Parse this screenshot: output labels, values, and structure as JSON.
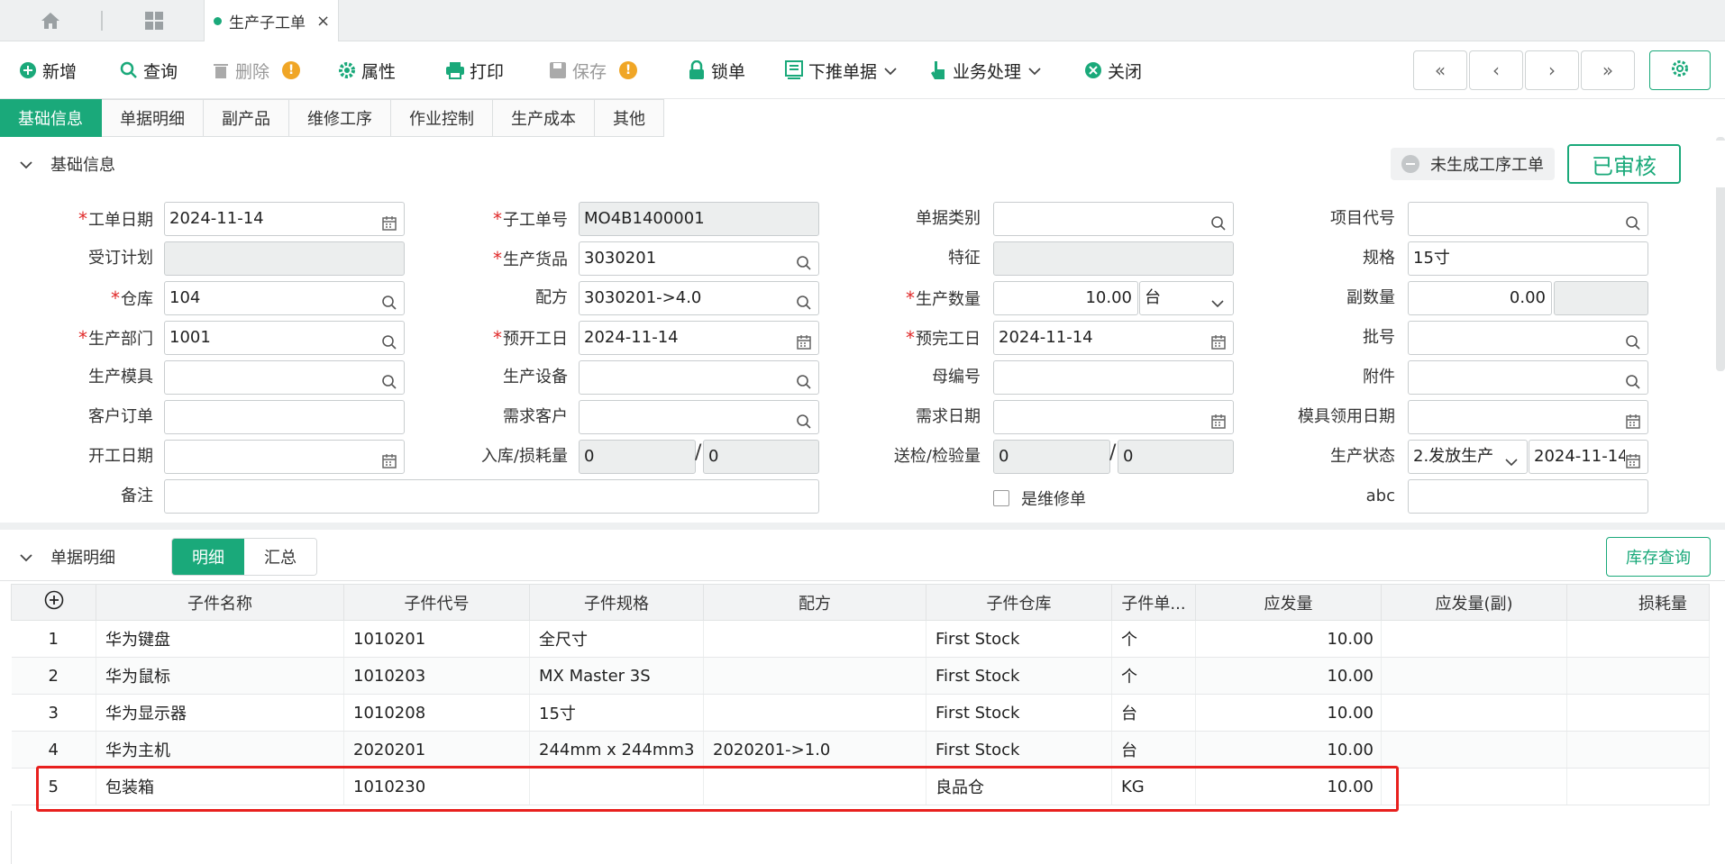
{
  "tabbar": {
    "active_tab": "生产子工单",
    "close": "×"
  },
  "toolbar": {
    "new": "新增",
    "query": "查询",
    "delete": "删除",
    "attr": "属性",
    "print": "打印",
    "save": "保存",
    "lock": "锁单",
    "push": "下推单据",
    "biz": "业务处理",
    "close": "关闭",
    "warn_mark": "!",
    "nav": [
      "«",
      "‹",
      "›",
      "»"
    ]
  },
  "subtabs": [
    "基础信息",
    "单据明细",
    "副产品",
    "维修工序",
    "作业控制",
    "生产成本",
    "其他"
  ],
  "basic": {
    "section_title": "基础信息",
    "unbuilt": "未生成工序工单",
    "approved": "已审核",
    "labels": {
      "work_date": "工单日期",
      "sub_no": "子工单号",
      "doc_type": "单据类别",
      "project": "项目代号",
      "order_plan": "受订计划",
      "goods": "生产货品",
      "feature": "特征",
      "spec": "规格",
      "warehouse": "仓库",
      "recipe": "配方",
      "qty": "生产数量",
      "sub_qty": "副数量",
      "dept": "生产部门",
      "plan_start": "预开工日",
      "plan_end": "预完工日",
      "batch": "批号",
      "mold": "生产模具",
      "equip": "生产设备",
      "parent_no": "母编号",
      "attach": "附件",
      "cust_order": "客户订单",
      "demand_cust": "需求客户",
      "demand_date": "需求日期",
      "mold_date": "模具领用日期",
      "start_date": "开工日期",
      "in_loss": "入库/损耗量",
      "inspect": "送检/检验量",
      "status": "生产状态",
      "remark": "备注",
      "is_repair": "是维修单",
      "abc": "abc"
    },
    "values": {
      "work_date": "2024-11-14",
      "sub_no": "MO4B1400001",
      "goods": "3030201",
      "spec": "15寸",
      "warehouse": "104",
      "recipe": "3030201->4.0",
      "qty": "10.00",
      "unit": "台",
      "sub_qty": "0.00",
      "dept": "1001",
      "plan_start": "2024-11-14",
      "plan_end": "2024-11-14",
      "in_qty": "0",
      "loss_qty": "0",
      "inspect_qty": "0",
      "checked_qty": "0",
      "status": "2.发放生产",
      "status_date": "2024-11-14"
    }
  },
  "detail": {
    "section_title": "单据明细",
    "seg": [
      "明细",
      "汇总"
    ],
    "stock_btn": "库存查询",
    "columns": [
      "子件名称",
      "子件代号",
      "子件规格",
      "配方",
      "子件仓库",
      "子件单...",
      "应发量",
      "应发量(副)",
      "损耗量"
    ],
    "rows": [
      {
        "no": "1",
        "name": "华为键盘",
        "code": "1010201",
        "spec": "全尺寸",
        "recipe": "",
        "wh": "First Stock",
        "unit": "个",
        "qty": "10.00"
      },
      {
        "no": "2",
        "name": "华为鼠标",
        "code": "1010203",
        "spec": "MX Master 3S",
        "recipe": "",
        "wh": "First Stock",
        "unit": "个",
        "qty": "10.00"
      },
      {
        "no": "3",
        "name": "华为显示器",
        "code": "1010208",
        "spec": "15寸",
        "recipe": "",
        "wh": "First Stock",
        "unit": "台",
        "qty": "10.00"
      },
      {
        "no": "4",
        "name": "华为主机",
        "code": "2020201",
        "spec": "244mm x 244mm3",
        "recipe": "2020201->1.0",
        "wh": "First Stock",
        "unit": "台",
        "qty": "10.00"
      },
      {
        "no": "5",
        "name": "包装箱",
        "code": "1010230",
        "spec": "",
        "recipe": "",
        "wh": "良品仓",
        "unit": "KG",
        "qty": "10.00"
      }
    ]
  },
  "colors": {
    "accent": "#1aa97a",
    "required": "#e02a2a",
    "warning": "#f0a626",
    "highlight": "#e8201e"
  }
}
